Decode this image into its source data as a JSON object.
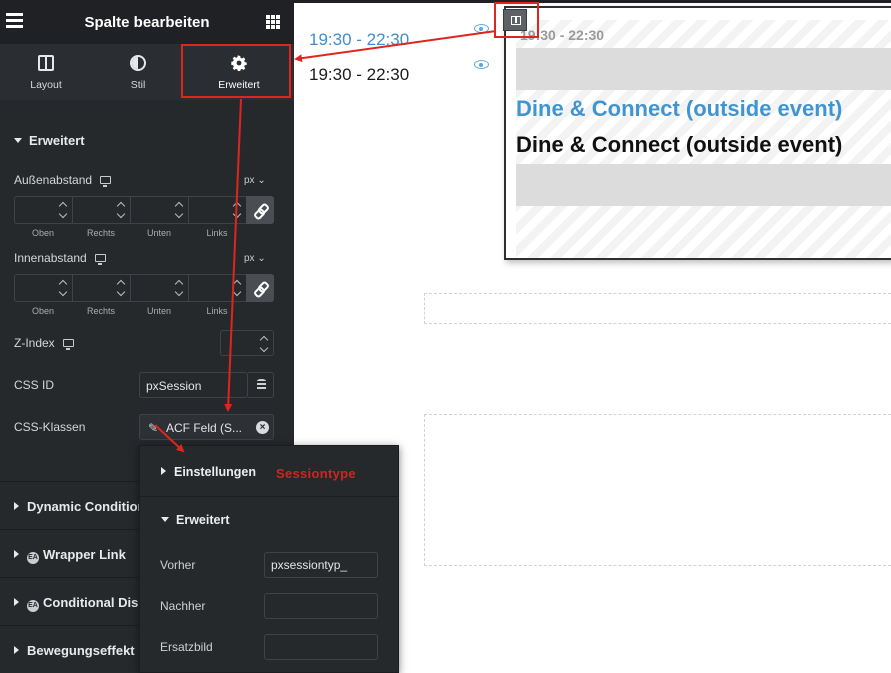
{
  "header": {
    "title": "Spalte bearbeiten"
  },
  "tabs": [
    {
      "label": "Layout",
      "icon": "layout-icon"
    },
    {
      "label": "Stil",
      "icon": "contrast-icon"
    },
    {
      "label": "Erweitert",
      "icon": "gear-icon",
      "active": true
    }
  ],
  "advanced": {
    "section_title": "Erweitert",
    "margin": {
      "label": "Außenabstand",
      "unit": "px"
    },
    "padding": {
      "label": "Innenabstand",
      "unit": "px"
    },
    "dimension_labels": [
      "Oben",
      "Rechts",
      "Unten",
      "Links"
    ],
    "zindex_label": "Z-Index",
    "css_id": {
      "label": "CSS ID",
      "value": "pxSession"
    },
    "css_classes": {
      "label": "CSS-Klassen",
      "tag": "ACF Feld (S..."
    }
  },
  "accordion": [
    {
      "label": "Dynamic Condition"
    },
    {
      "label": "Wrapper Link",
      "badge": "EA"
    },
    {
      "label": "Conditional Dis",
      "badge": "EA"
    },
    {
      "label": "Bewegungseffekt"
    }
  ],
  "popover": {
    "settings_label": "Einstellungen",
    "settings_note": "Sessiontype",
    "advanced_label": "Erweitert",
    "before": {
      "label": "Vorher",
      "value": "pxsessiontyp_"
    },
    "after": {
      "label": "Nachher",
      "value": ""
    },
    "fallback": {
      "label": "Ersatzbild",
      "value": ""
    }
  },
  "canvas": {
    "time_1": "19:30 - 22:30",
    "time_2": "19:30 - 22:30",
    "preview": {
      "time": "19:30 - 22:30",
      "title_1": "Dine & Connect (outside event)",
      "title_2": "Dine & Connect (outside event)"
    }
  },
  "colors": {
    "sidebar_bg": "#26292c",
    "annotation_red": "#e0251f",
    "link_blue": "#3f95d1"
  }
}
